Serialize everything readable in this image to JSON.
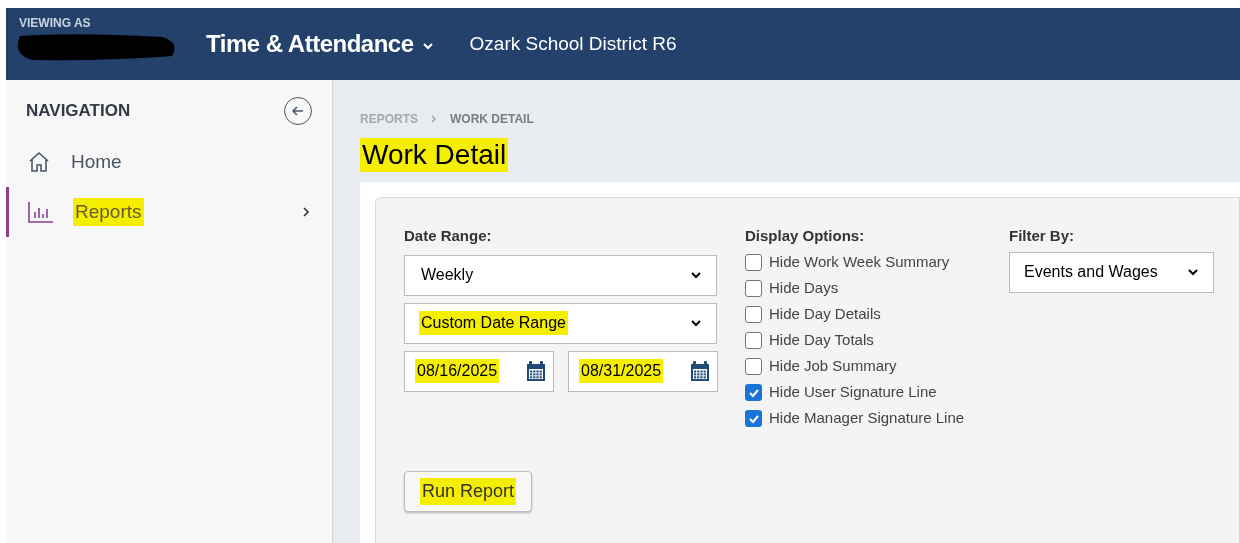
{
  "header": {
    "viewing_as_label": "VIEWING AS",
    "app_title": "Time & Attendance",
    "organization": "Ozark School District R6"
  },
  "sidebar": {
    "title": "NAVIGATION",
    "items": [
      {
        "label": "Home",
        "kind": "home",
        "selected": false,
        "highlighted": false,
        "has_children": false
      },
      {
        "label": "Reports",
        "kind": "chart",
        "selected": true,
        "highlighted": true,
        "has_children": true
      }
    ]
  },
  "breadcrumb": [
    "REPORTS",
    "WORK DETAIL"
  ],
  "page_title": {
    "text": "Work Detail",
    "highlighted": true
  },
  "form": {
    "date_range": {
      "label": "Date Range:",
      "selects": [
        {
          "value": "Weekly",
          "highlighted": false
        },
        {
          "value": "Custom Date Range",
          "highlighted": true
        }
      ],
      "dates": [
        {
          "value": "08/16/2025",
          "highlighted": true
        },
        {
          "value": "08/31/2025",
          "highlighted": true
        }
      ]
    },
    "display_options": {
      "label": "Display Options:",
      "options": [
        {
          "label": "Hide Work Week Summary",
          "checked": false
        },
        {
          "label": "Hide Days",
          "checked": false
        },
        {
          "label": "Hide Day Details",
          "checked": false
        },
        {
          "label": "Hide Day Totals",
          "checked": false
        },
        {
          "label": "Hide Job Summary",
          "checked": false
        },
        {
          "label": "Hide User Signature Line",
          "checked": true
        },
        {
          "label": "Hide Manager Signature Line",
          "checked": true
        }
      ]
    },
    "filter_by": {
      "label": "Filter By:",
      "value": "Events and Wages"
    },
    "run_button": {
      "label": "Run Report",
      "highlighted": true
    }
  }
}
